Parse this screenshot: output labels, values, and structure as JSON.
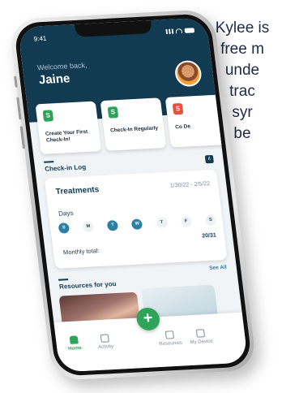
{
  "marketing": {
    "lines": [
      "Kylee is",
      "free m",
      "unde",
      "trac",
      "syr",
      "be"
    ]
  },
  "status": {
    "time": "9:41"
  },
  "header": {
    "welcome": "Welcome back,",
    "name": "Jaine"
  },
  "cards": [
    {
      "icon": "S",
      "title": "Create Your First Check-In!"
    },
    {
      "icon": "S",
      "title": "Check-In Regularly"
    },
    {
      "icon": "S",
      "title": "Co De"
    }
  ],
  "checkin": {
    "section_title": "Check-in Log",
    "treatments_title": "Treatments",
    "date_range": "1/30/22 - 2/5/22",
    "days_label": "Days",
    "days": [
      {
        "label": "S",
        "active": true
      },
      {
        "label": "M",
        "active": false
      },
      {
        "label": "T",
        "active": true
      },
      {
        "label": "W",
        "active": true
      },
      {
        "label": "T",
        "active": false
      },
      {
        "label": "F",
        "active": false
      },
      {
        "label": "S",
        "active": false
      }
    ],
    "monthly_label": "Monthly total:",
    "monthly_count": "20/31"
  },
  "resources": {
    "section_title": "Resources for you",
    "see_all": "See All"
  },
  "tabbar": {
    "home": "Home",
    "activity": "Activity",
    "add": "+",
    "resources": "Resources",
    "device": "My Device"
  },
  "colors": {
    "header": "#123b52",
    "accent_green": "#2fa35a",
    "day_active": "#2d7ea3"
  }
}
